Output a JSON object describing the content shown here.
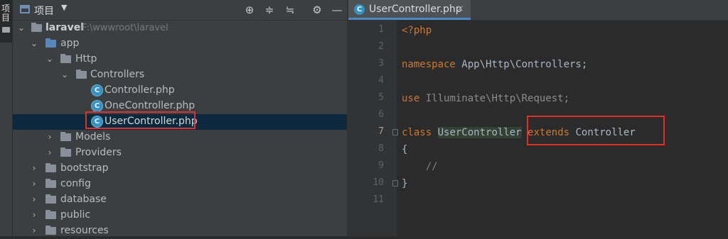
{
  "left_strip": {
    "vertical_text": "项目"
  },
  "project_panel": {
    "title": "项目",
    "toolbar_icons": [
      "locate-icon",
      "expand-all-icon",
      "collapse-all-icon",
      "gear-icon",
      "minimize-icon"
    ],
    "tree": [
      {
        "label": "laravel",
        "path": "F:\\wwwroot\\laravel",
        "expanded": true,
        "type": "folder"
      },
      {
        "label": "app",
        "expanded": true,
        "type": "folder"
      },
      {
        "label": "Http",
        "expanded": true,
        "type": "folder"
      },
      {
        "label": "Controllers",
        "expanded": true,
        "type": "folder"
      },
      {
        "label": "Controller.php",
        "type": "php-class"
      },
      {
        "label": "OneController.php",
        "type": "php-class"
      },
      {
        "label": "UserController.php",
        "type": "php-class",
        "selected": true
      },
      {
        "label": "Models",
        "expanded": false,
        "type": "folder"
      },
      {
        "label": "Providers",
        "expanded": false,
        "type": "folder"
      },
      {
        "label": "bootstrap",
        "expanded": false,
        "type": "folder"
      },
      {
        "label": "config",
        "expanded": false,
        "type": "folder"
      },
      {
        "label": "database",
        "expanded": false,
        "type": "folder"
      },
      {
        "label": "public",
        "expanded": false,
        "type": "folder"
      },
      {
        "label": "resources",
        "expanded": false,
        "type": "folder"
      }
    ]
  },
  "editor": {
    "tab": {
      "label": "UserController.php",
      "close": "×"
    },
    "current_line": "7",
    "lines": [
      {
        "num": "1",
        "text": "<?php"
      },
      {
        "num": "2",
        "text": ""
      },
      {
        "num": "3",
        "kw": "namespace",
        "rest": " App\\Http\\Controllers;"
      },
      {
        "num": "4",
        "text": ""
      },
      {
        "num": "5",
        "kw": "use",
        "rest": " Illuminate\\Http\\Request;"
      },
      {
        "num": "6",
        "text": ""
      },
      {
        "num": "7",
        "kw": "class",
        "cls": "UserController",
        "kw2": "extends",
        "rest": " Controller"
      },
      {
        "num": "8",
        "text": "{"
      },
      {
        "num": "9",
        "text": "    //"
      },
      {
        "num": "10",
        "text": "}"
      },
      {
        "num": "11",
        "text": ""
      }
    ]
  },
  "colors": {
    "keyword": "#cc7832",
    "identifier": "#a9b7c6",
    "comment": "#808080",
    "selection": "#0d293e",
    "annotation_box": "#e0302e",
    "php_icon": "#3592c4"
  }
}
